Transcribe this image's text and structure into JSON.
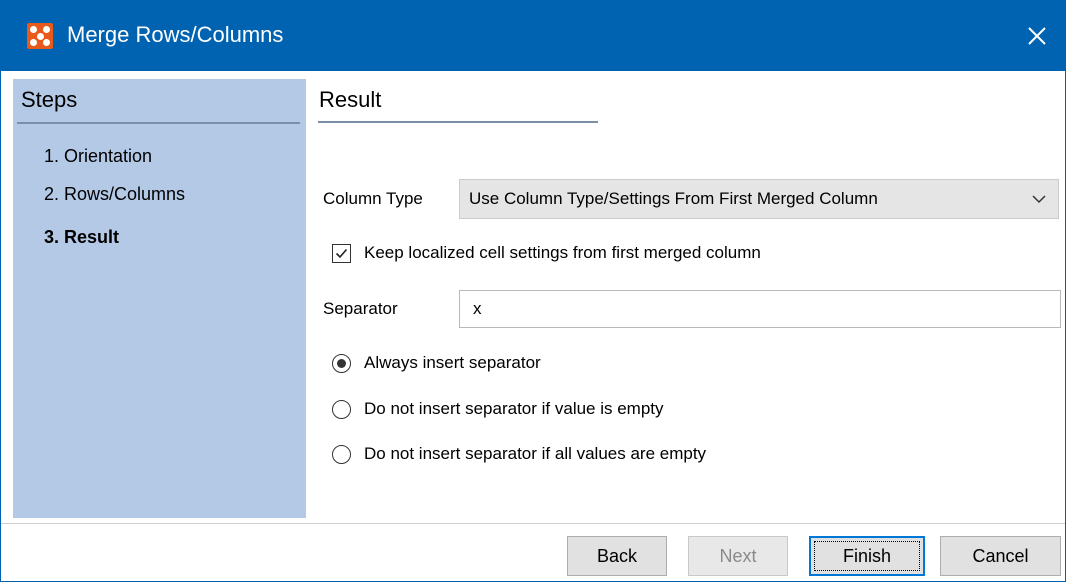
{
  "window": {
    "title": "Merge Rows/Columns",
    "app_icon": "app-grid-icon",
    "close_icon": "close-icon",
    "accent_color": "#0063b1"
  },
  "steps": {
    "title": "Steps",
    "items": [
      {
        "label": "1. Orientation",
        "current": false
      },
      {
        "label": "2. Rows/Columns",
        "current": false
      },
      {
        "label": "3. Result",
        "current": true
      }
    ],
    "panel_color": "#b3c9e6"
  },
  "result": {
    "title": "Result",
    "column_type": {
      "label": "Column Type",
      "selected": "Use Column Type/Settings From First Merged Column"
    },
    "keep_localized": {
      "label": "Keep localized cell settings from first merged column",
      "checked": true
    },
    "separator": {
      "label": "Separator",
      "value": "x"
    },
    "separator_mode": [
      {
        "label": "Always insert separator",
        "checked": true
      },
      {
        "label": "Do not insert separator if value is empty",
        "checked": false
      },
      {
        "label": "Do not insert separator if all values are empty",
        "checked": false
      }
    ]
  },
  "buttons": {
    "back": "Back",
    "next": "Next",
    "finish": "Finish",
    "cancel": "Cancel"
  }
}
